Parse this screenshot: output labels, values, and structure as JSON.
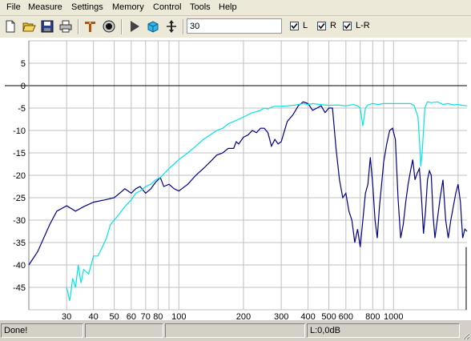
{
  "menu": [
    "File",
    "Measure",
    "Settings",
    "Memory",
    "Control",
    "Tools",
    "Help"
  ],
  "toolbar": {
    "buttons": [
      "new-icon",
      "open-folder-icon",
      "save-icon",
      "print-icon",
      "marker-icon",
      "record-icon",
      "play-icon",
      "3d-view-icon",
      "pan-icon"
    ],
    "freq_value": "30",
    "checks": [
      {
        "label": "L",
        "checked": true
      },
      {
        "label": "R",
        "checked": true
      },
      {
        "label": "L-R",
        "checked": true
      }
    ]
  },
  "chart_data": {
    "type": "line",
    "x_scale": "log",
    "xlim": [
      20,
      2200
    ],
    "ylim": [
      -50,
      10
    ],
    "grid": true,
    "x_tick_labels": [
      "30",
      "40",
      "50",
      "60",
      "70",
      "80",
      "100",
      "200",
      "300",
      "400",
      "500",
      "600",
      "800",
      "1000"
    ],
    "y_tick_labels": [
      "5",
      "0",
      "-5",
      "-10",
      "-15",
      "-20",
      "-25",
      "-30",
      "-35",
      "-40",
      "-45"
    ],
    "series": [
      {
        "color": "#00008b",
        "x": [
          20,
          22,
          25,
          27,
          30,
          33,
          36,
          40,
          45,
          50,
          53,
          56,
          60,
          63,
          66,
          70,
          74,
          78,
          82,
          85,
          90,
          95,
          100,
          110,
          120,
          130,
          140,
          150,
          160,
          170,
          180,
          185,
          190,
          200,
          210,
          220,
          230,
          240,
          250,
          260,
          270,
          280,
          290,
          300,
          320,
          340,
          360,
          380,
          400,
          420,
          440,
          460,
          480,
          500,
          520,
          540,
          560,
          580,
          600,
          620,
          640,
          660,
          680,
          700,
          720,
          740,
          760,
          780,
          800,
          820,
          840,
          860,
          880,
          900,
          930,
          960,
          990,
          1020,
          1050,
          1080,
          1110,
          1140,
          1170,
          1200,
          1230,
          1260,
          1290,
          1320,
          1350,
          1380,
          1410,
          1440,
          1470,
          1500,
          1530,
          1560,
          1600,
          1650,
          1700,
          1750,
          1800,
          1850,
          1900,
          1950,
          2000,
          2050,
          2100,
          2150,
          2200
        ],
        "y": [
          -40,
          -37,
          -31,
          -28,
          -26.8,
          -28,
          -27,
          -26,
          -25.5,
          -25,
          -24,
          -23,
          -24,
          -23,
          -22.5,
          -24,
          -23,
          -21.5,
          -20.5,
          -22.5,
          -22,
          -23,
          -23.5,
          -22,
          -20,
          -18.5,
          -17,
          -15.5,
          -15,
          -14,
          -14,
          -12.5,
          -13,
          -11.5,
          -11,
          -10,
          -10.5,
          -9.5,
          -9.5,
          -10.5,
          -13.5,
          -12,
          -13,
          -12.5,
          -8,
          -6.5,
          -4.5,
          -3.6,
          -4,
          -5.5,
          -5,
          -4.5,
          -6,
          -5,
          -5,
          -14,
          -21,
          -25,
          -24,
          -28,
          -30,
          -35,
          -32,
          -36,
          -30,
          -24,
          -22,
          -16,
          -22,
          -30,
          -34,
          -27,
          -22,
          -17,
          -13,
          -10,
          -9.5,
          -12,
          -25,
          -34,
          -31,
          -26,
          -22,
          -19,
          -16.5,
          -21,
          -19.5,
          -18.5,
          -25,
          -33,
          -28,
          -21,
          -19,
          -20,
          -29,
          -34,
          -30,
          -25,
          -21,
          -30,
          -34,
          -30,
          -27,
          -24,
          -22,
          -26,
          -34,
          -32,
          -32.5
        ]
      },
      {
        "color": "#00e5e5",
        "x": [
          30,
          31,
          32,
          33,
          34,
          35,
          36,
          38,
          40,
          42,
          44,
          46,
          48,
          50,
          53,
          56,
          60,
          63,
          66,
          70,
          74,
          78,
          82,
          86,
          90,
          95,
          100,
          110,
          120,
          130,
          140,
          150,
          160,
          170,
          180,
          190,
          200,
          210,
          220,
          230,
          240,
          250,
          260,
          270,
          280,
          300,
          320,
          350,
          380,
          400,
          420,
          450,
          480,
          500,
          550,
          600,
          650,
          680,
          700,
          710,
          720,
          730,
          740,
          760,
          800,
          850,
          900,
          1000,
          1100,
          1200,
          1250,
          1300,
          1320,
          1340,
          1360,
          1380,
          1400,
          1420,
          1440,
          1500,
          1600,
          1700,
          1800,
          1900,
          2000,
          2100,
          2200
        ],
        "y": [
          -45,
          -48,
          -43,
          -45,
          -40,
          -44,
          -41,
          -42,
          -38,
          -38,
          -36,
          -34,
          -31,
          -30,
          -28.5,
          -27,
          -25.5,
          -24,
          -23.5,
          -22.5,
          -22,
          -21,
          -20.5,
          -19.5,
          -18.5,
          -17.5,
          -16.5,
          -15,
          -13.5,
          -12,
          -11,
          -10,
          -9.5,
          -8.5,
          -8,
          -7.5,
          -7,
          -6.5,
          -6,
          -5.8,
          -5.5,
          -5,
          -5.2,
          -4.8,
          -4.6,
          -4.6,
          -4.5,
          -4.3,
          -4,
          -4.2,
          -4,
          -4.2,
          -4.3,
          -4.4,
          -4.3,
          -4.5,
          -4.2,
          -4.5,
          -5,
          -7,
          -9,
          -7,
          -5,
          -4.3,
          -4,
          -4.2,
          -4,
          -4,
          -4,
          -4,
          -4.5,
          -7,
          -12,
          -18,
          -15,
          -10,
          -5,
          -4.2,
          -3.6,
          -3.8,
          -3.6,
          -4.2,
          -4,
          -4.3,
          -4.2,
          -4.4,
          -4.5
        ]
      }
    ]
  },
  "status": {
    "left": "Done!",
    "mid1": "",
    "mid2": "",
    "right": "L:0,0dB"
  }
}
